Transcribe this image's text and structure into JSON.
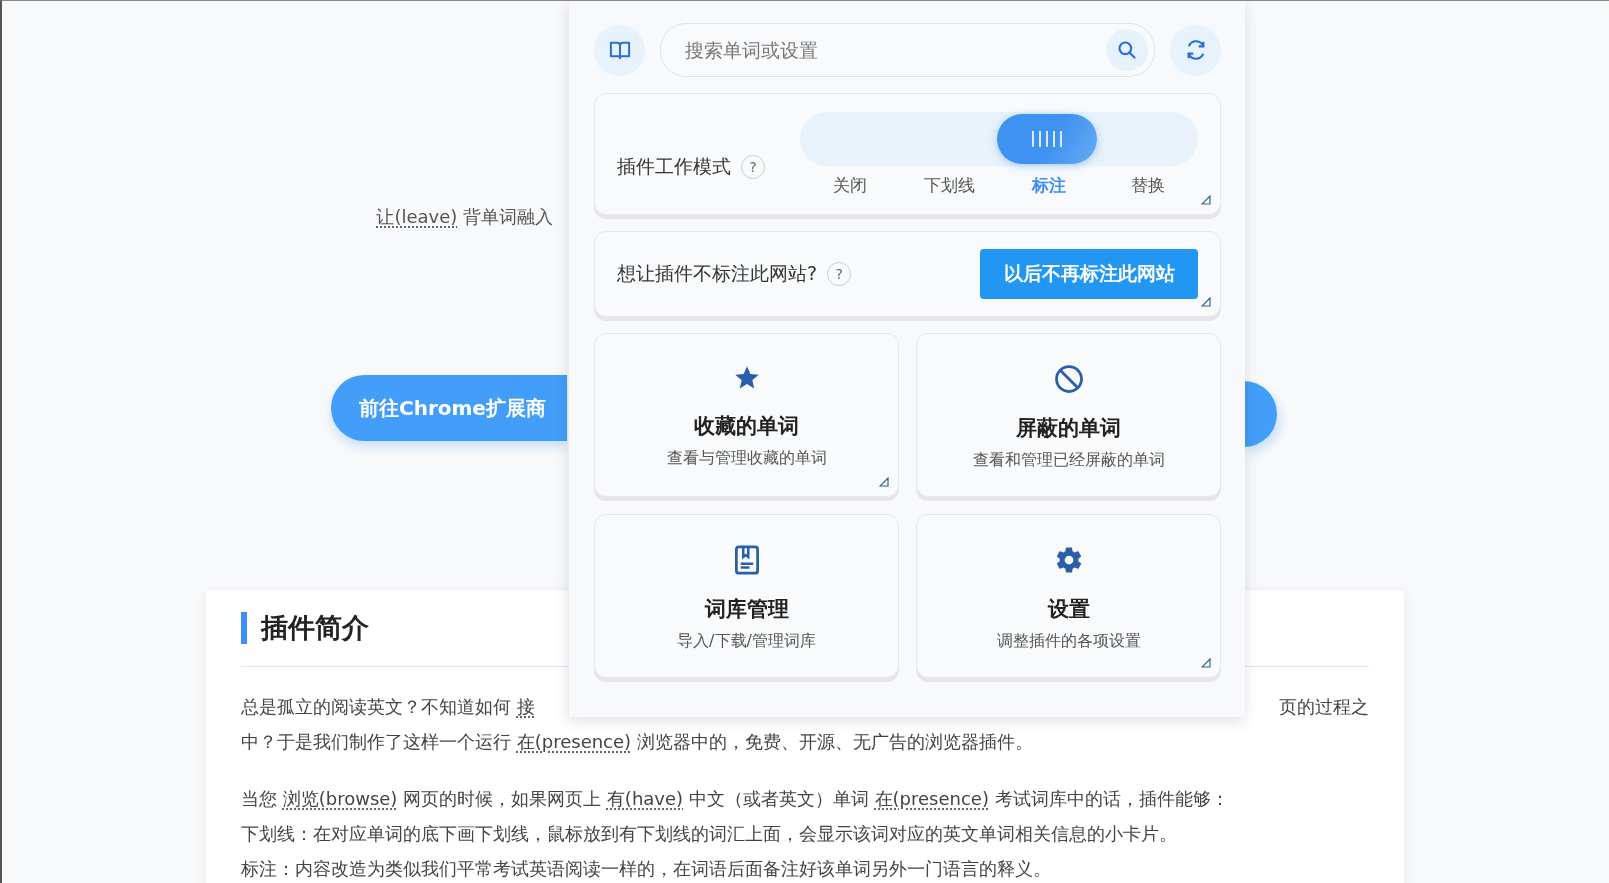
{
  "page": {
    "tagline": [
      {
        "kind": "annotated",
        "text": "让(leave)"
      },
      {
        "kind": "plain",
        "text": " 背单词融入"
      }
    ],
    "store_button": "前往Chrome扩展商",
    "intro": {
      "heading": "插件简介",
      "first_line_left": [
        {
          "kind": "plain",
          "text": "总是孤立的阅读英文？不知道如何 "
        },
        {
          "kind": "annotated",
          "text": "接"
        }
      ],
      "first_line_right": "页的过程之",
      "lines": [
        [
          {
            "kind": "plain",
            "text": "中？于是我们制作了这样一个运行 "
          },
          {
            "kind": "annotated",
            "text": "在(presence)"
          },
          {
            "kind": "plain",
            "text": " 浏览器中的，免费、开源、无广告的浏览器插件。"
          }
        ],
        [
          {
            "kind": "plain",
            "text": "当您 "
          },
          {
            "kind": "annotated",
            "text": "浏览(browse)"
          },
          {
            "kind": "plain",
            "text": " 网页的时候，如果网页上 "
          },
          {
            "kind": "annotated",
            "text": "有(have)"
          },
          {
            "kind": "plain",
            "text": " 中文（或者英文）单词 "
          },
          {
            "kind": "annotated",
            "text": "在(presence)"
          },
          {
            "kind": "plain",
            "text": " 考试词库中的话，插件能够："
          }
        ],
        [
          {
            "kind": "plain",
            "text": "下划线：在对应单词的底下画下划线，鼠标放到有下划线的词汇上面，会显示该词对应的英文单词相关信息的小卡片。"
          }
        ],
        [
          {
            "kind": "plain",
            "text": "标注：内容改造为类似我们平常考试英语阅读一样的，在词语后面备注好该单词另外一门语言的释义。"
          }
        ]
      ]
    }
  },
  "popup": {
    "search": {
      "placeholder": "搜索单词或设置"
    },
    "mode": {
      "label": "插件工作模式",
      "help": "?",
      "corner_mark": true,
      "options": [
        {
          "label": "关闭",
          "selected": false
        },
        {
          "label": "下划线",
          "selected": false
        },
        {
          "label": "标注",
          "selected": true
        },
        {
          "label": "替换",
          "selected": false
        }
      ]
    },
    "site": {
      "label": "想让插件不标注此网站?",
      "help": "?",
      "button": "以后不再标注此网站",
      "corner_mark": true
    },
    "cards": [
      {
        "kind": "star",
        "title": "收藏的单词",
        "subtitle": "查看与管理收藏的单词",
        "corner_mark": true
      },
      {
        "kind": "block",
        "title": "屏蔽的单词",
        "subtitle": "查看和管理已经屏蔽的单词",
        "corner_mark": false
      },
      {
        "kind": "book",
        "title": "词库管理",
        "subtitle": "导入/下载/管理词库",
        "corner_mark": false
      },
      {
        "kind": "gear",
        "title": "设置",
        "subtitle": "调整插件的各项设置",
        "corner_mark": true
      }
    ]
  }
}
